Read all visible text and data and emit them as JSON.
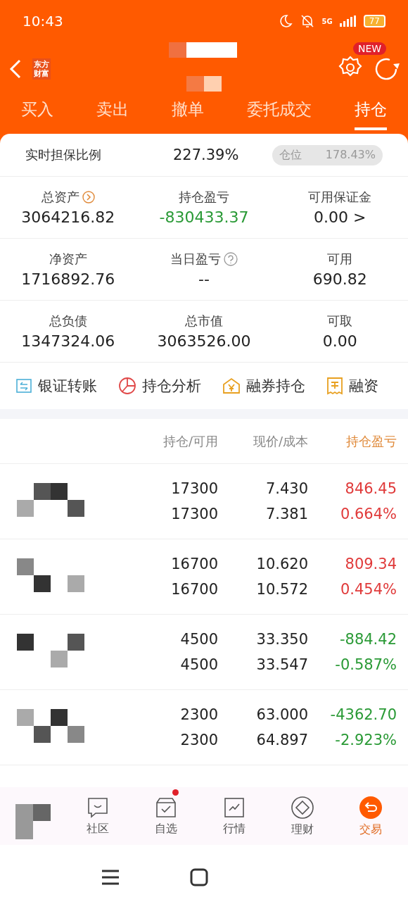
{
  "status_bar": {
    "time": "10:43",
    "battery": "77",
    "network": "5G"
  },
  "header": {
    "badge": "NEW",
    "logo_lines": [
      "东方",
      "财富"
    ]
  },
  "tabs": [
    {
      "label": "买入",
      "selected": false
    },
    {
      "label": "卖出",
      "selected": false
    },
    {
      "label": "撤单",
      "selected": false
    },
    {
      "label": "委托成交",
      "selected": false
    },
    {
      "label": "持仓",
      "selected": true
    }
  ],
  "ratio": {
    "label": "实时担保比例",
    "value": "227.39%",
    "position_label": "仓位",
    "position_value": "178.43%"
  },
  "summary": [
    {
      "label": "总资产",
      "value": "3064216.82",
      "kind": "arrow",
      "color": "#222222"
    },
    {
      "label": "持仓盈亏",
      "value": "-830433.37",
      "kind": "none",
      "color": "#2a9a36"
    },
    {
      "label": "可用保证金",
      "value": "0.00 >",
      "kind": "none",
      "color": "#222222"
    },
    {
      "label": "净资产",
      "value": "1716892.76",
      "kind": "none",
      "color": "#222222"
    },
    {
      "label": "当日盈亏",
      "value": "--",
      "kind": "help",
      "color": "#222222"
    },
    {
      "label": "可用",
      "value": "690.82",
      "kind": "none",
      "color": "#222222"
    },
    {
      "label": "总负债",
      "value": "1347324.06",
      "kind": "none",
      "color": "#222222"
    },
    {
      "label": "总市值",
      "value": "3063526.00",
      "kind": "none",
      "color": "#222222"
    },
    {
      "label": "可取",
      "value": "0.00",
      "kind": "none",
      "color": "#222222"
    }
  ],
  "shortcuts": [
    {
      "label": "银证转账",
      "kind": "transfer"
    },
    {
      "label": "持仓分析",
      "kind": "pie"
    },
    {
      "label": "融券持仓",
      "kind": "house"
    },
    {
      "label": "融资",
      "kind": "bill"
    }
  ],
  "table": {
    "columns": [
      "持仓/可用",
      "现价/成本",
      "持仓盈亏"
    ],
    "rows": [
      {
        "holding": "17300",
        "available": "17300",
        "price": "7.430",
        "cost": "7.381",
        "pnl": "846.45",
        "pnl_pct": "0.664%",
        "color": "#e03a3a"
      },
      {
        "holding": "16700",
        "available": "16700",
        "price": "10.620",
        "cost": "10.572",
        "pnl": "809.34",
        "pnl_pct": "0.454%",
        "color": "#e03a3a"
      },
      {
        "holding": "4500",
        "available": "4500",
        "price": "33.350",
        "cost": "33.547",
        "pnl": "-884.42",
        "pnl_pct": "-0.587%",
        "color": "#2a9a36"
      },
      {
        "holding": "2300",
        "available": "2300",
        "price": "63.000",
        "cost": "64.897",
        "pnl": "-4362.70",
        "pnl_pct": "-2.923%",
        "color": "#2a9a36"
      }
    ]
  },
  "bottom_nav": [
    {
      "label": "社区",
      "kind": "chat",
      "selected": false,
      "dot": false
    },
    {
      "label": "自选",
      "kind": "check",
      "selected": false,
      "dot": true
    },
    {
      "label": "行情",
      "kind": "chart",
      "selected": false,
      "dot": false
    },
    {
      "label": "理财",
      "kind": "diamond",
      "selected": false,
      "dot": false
    },
    {
      "label": "交易",
      "kind": "trade",
      "selected": true,
      "dot": false
    }
  ]
}
